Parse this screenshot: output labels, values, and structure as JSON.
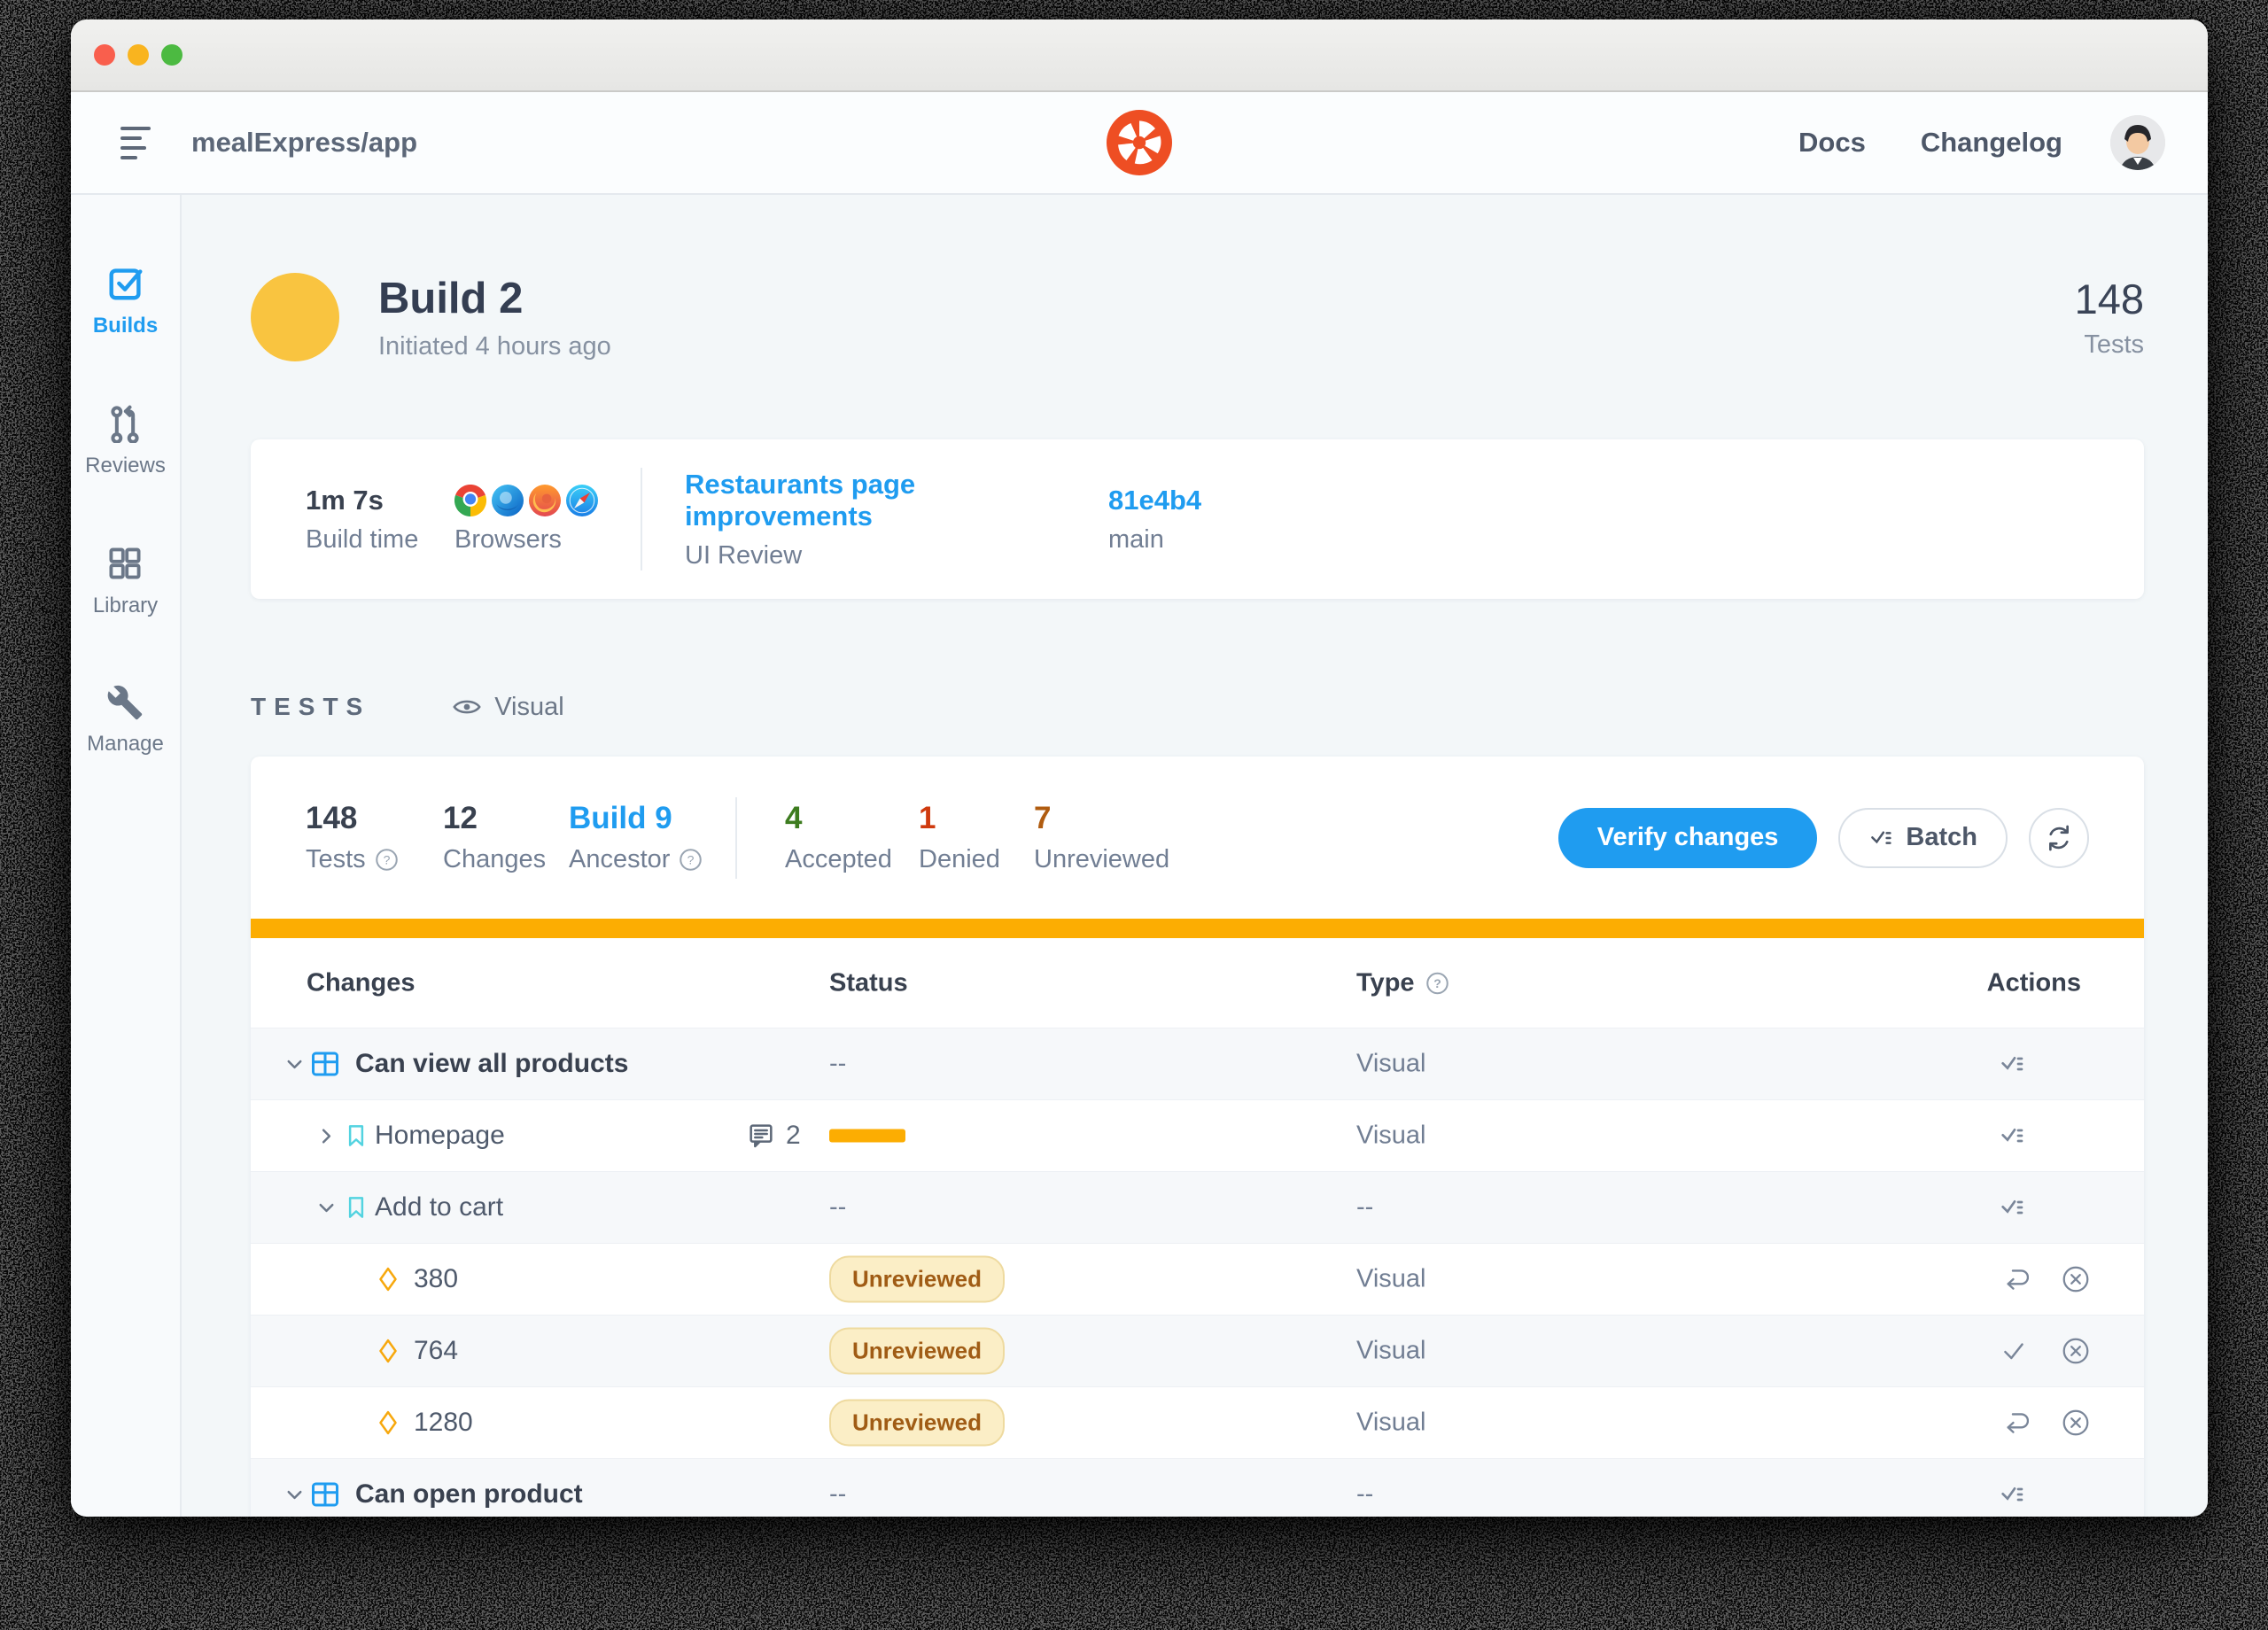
{
  "navbar": {
    "project": "mealExpress/app",
    "docs_label": "Docs",
    "changelog_label": "Changelog"
  },
  "sidebar": {
    "items": [
      {
        "label": "Builds",
        "icon": "checkbox-icon",
        "active": true
      },
      {
        "label": "Reviews",
        "icon": "pull-request-icon",
        "active": false
      },
      {
        "label": "Library",
        "icon": "grid-icon",
        "active": false
      },
      {
        "label": "Manage",
        "icon": "wrench-icon",
        "active": false
      }
    ]
  },
  "build_header": {
    "title": "Build 2",
    "subtitle": "Initiated 4 hours ago",
    "tests_count": "148",
    "tests_label": "Tests"
  },
  "summary_card": {
    "build_time_value": "1m 7s",
    "build_time_label": "Build time",
    "browsers_label": "Browsers",
    "browsers": [
      "chrome",
      "edge",
      "firefox",
      "safari"
    ],
    "review_title": "Restaurants page improvements",
    "review_label": "UI Review",
    "commit": "81e4b4",
    "branch": "main"
  },
  "tests_section": {
    "heading": "TESTS",
    "filter_label": "Visual"
  },
  "stats": {
    "tests": {
      "value": "148",
      "label": "Tests"
    },
    "changes": {
      "value": "12",
      "label": "Changes"
    },
    "ancestor": {
      "value": "Build 9",
      "label": "Ancestor"
    },
    "accepted": {
      "value": "4",
      "label": "Accepted"
    },
    "denied": {
      "value": "1",
      "label": "Denied"
    },
    "unreviewed": {
      "value": "7",
      "label": "Unreviewed"
    }
  },
  "toolbar": {
    "verify_label": "Verify changes",
    "batch_label": "Batch"
  },
  "table": {
    "columns": [
      "Changes",
      "Status",
      "Type",
      "Actions"
    ],
    "rows": [
      {
        "name": "Can view all products",
        "status": "--",
        "type": "Visual"
      },
      {
        "name": "Homepage",
        "comments": "2",
        "type": "Visual"
      },
      {
        "name": "Add to cart",
        "status": "--",
        "type": "--"
      },
      {
        "name": "380",
        "badge": "Unreviewed",
        "type": "Visual"
      },
      {
        "name": "764",
        "badge": "Unreviewed",
        "type": "Visual"
      },
      {
        "name": "1280",
        "badge": "Unreviewed",
        "type": "Visual"
      },
      {
        "name": "Can open product",
        "status": "--",
        "type": "--"
      }
    ]
  },
  "glyphs": {
    "question": "?"
  },
  "colors": {
    "blue": "#1f9cf0",
    "orange": "#fcad02",
    "yellow": "#f9c440",
    "green": "#3d7c1f",
    "red": "#cf3a0e",
    "brown": "#b05c10",
    "teal": "#53d3e0",
    "diamond": "#f7a80d",
    "badge_bg": "#fbeec6",
    "badge_border": "#eeda9f",
    "badge_text": "#a05c15"
  }
}
